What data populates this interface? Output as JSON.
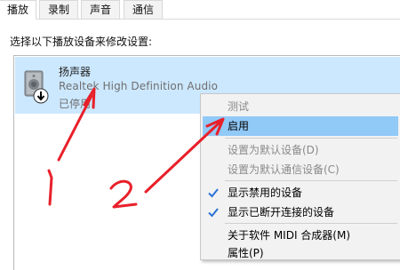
{
  "tabs": [
    "播放",
    "录制",
    "声音",
    "通信"
  ],
  "instruction": "选择以下播放设备来修改设置:",
  "device": {
    "name": "扬声器",
    "description": "Realtek High Definition Audio",
    "status": "已停用"
  },
  "context_menu": {
    "items": [
      {
        "label": "测试",
        "state": "disabled"
      },
      {
        "label": "启用",
        "state": "highlighted"
      },
      {
        "label": "设置为默认设备(D)",
        "state": "disabled"
      },
      {
        "label": "设置为默认通信设备(C)",
        "state": "disabled"
      },
      {
        "label": "显示禁用的设备",
        "checked": true
      },
      {
        "label": "显示已断开连接的设备",
        "checked": true
      },
      {
        "label": "关于软件 MIDI 合成器(M)"
      },
      {
        "label": "属性(P)"
      }
    ]
  },
  "annotations": {
    "numbers": [
      "1",
      "2"
    ],
    "color": "#e8202a"
  },
  "colors": {
    "selection": "#cce8ff",
    "menu_highlight": "#91c9f7",
    "check_blue": "#2a73d6"
  }
}
